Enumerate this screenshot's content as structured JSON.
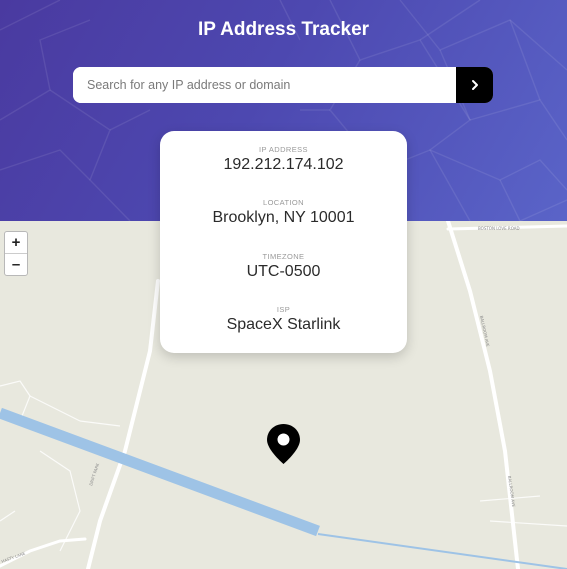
{
  "header": {
    "title": "IP Address Tracker"
  },
  "search": {
    "placeholder": "Search for any IP address or domain",
    "value": "",
    "submit_icon": "chevron-right-icon"
  },
  "info": {
    "ip_label": "IP ADDRESS",
    "ip_value": "192.212.174.102",
    "location_label": "LOCATION",
    "location_value": "Brooklyn, NY 10001",
    "timezone_label": "TIMEZONE",
    "timezone_value": "UTC-0500",
    "isp_label": "ISP",
    "isp_value": "SpaceX Starlink"
  },
  "map": {
    "zoom_in": "+",
    "zoom_out": "–",
    "marker_icon": "location-pin-icon",
    "road_labels": [
      "BOSTON LOVE ROAD",
      "BALLROOM AVE",
      "DRIFT PARK",
      "HASTY LANE",
      "BALLROOM AVE"
    ]
  },
  "colors": {
    "header_gradient_start": "#4a3aa0",
    "header_gradient_end": "#5a64c8",
    "map_background": "#e8e8de",
    "water": "#9ec3e6",
    "button": "#000000"
  }
}
